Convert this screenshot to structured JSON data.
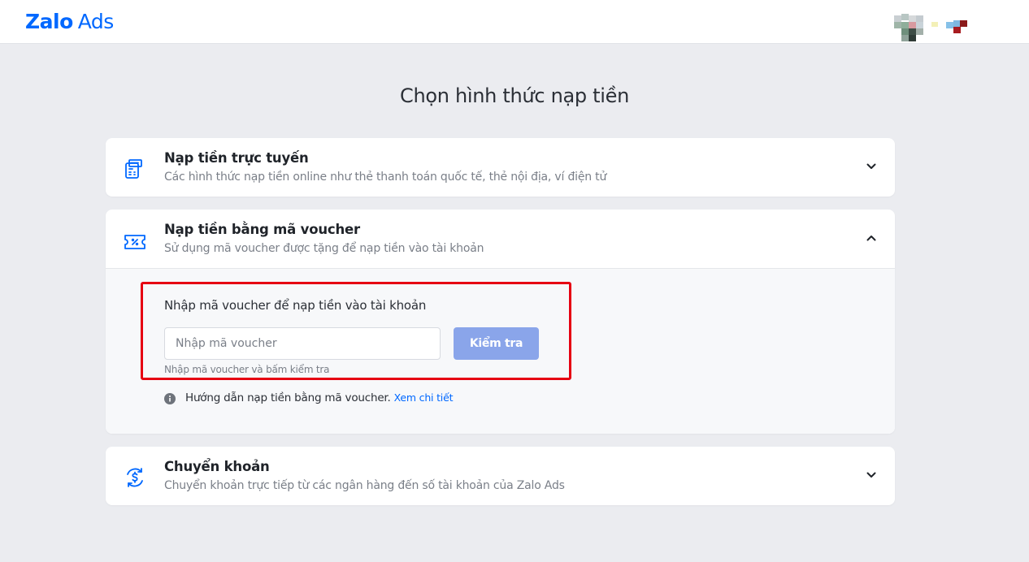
{
  "header": {
    "logo_bold": "Zalo",
    "logo_light": "Ads"
  },
  "page": {
    "title": "Chọn hình thức nạp tiền"
  },
  "methods": [
    {
      "title": "Nạp tiền trực tuyến",
      "subtitle": "Các hình thức nạp tiền online như thẻ thanh toán quốc tế, thẻ nội địa, ví điện tử",
      "icon": "card-terminal-icon",
      "expanded": false
    },
    {
      "title": "Nạp tiền bằng mã voucher",
      "subtitle": "Sử dụng mã voucher được tặng để nạp tiền vào tài khoản",
      "icon": "voucher-ticket-icon",
      "expanded": true
    },
    {
      "title": "Chuyển khoản",
      "subtitle": "Chuyển khoản trực tiếp từ các ngân hàng đến số tài khoản của Zalo Ads",
      "icon": "money-transfer-icon",
      "expanded": false
    }
  ],
  "voucher": {
    "label": "Nhập mã voucher để nạp tiền vào tài khoản",
    "input_value": "",
    "input_placeholder": "Nhập mã voucher",
    "check_button": "Kiểm tra",
    "hint": "Nhập mã voucher và bấm kiểm tra",
    "guide_text": "Hướng dẫn nạp tiền bằng mã voucher.",
    "guide_link": "Xem chi tiết"
  },
  "colors": {
    "brand": "#0068ff",
    "button_disabled": "#8aa5ea",
    "highlight_border": "#e60012",
    "page_background": "#ebecf0"
  }
}
